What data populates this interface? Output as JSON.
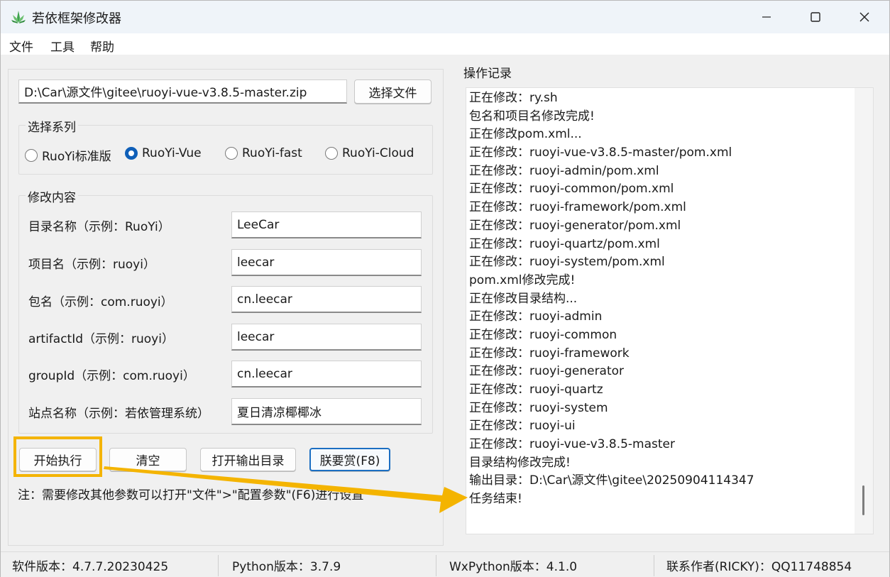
{
  "window": {
    "title": "若依框架修改器",
    "minimize_icon": "minimize-icon",
    "maximize_icon": "maximize-icon",
    "close_icon": "close-icon"
  },
  "menu": [
    "文件",
    "工具",
    "帮助"
  ],
  "file": {
    "path_value": "D:\\Car\\源文件\\gitee\\ruoyi-vue-v3.8.5-master.zip",
    "choose_label": "选择文件"
  },
  "series": {
    "group_label": "选择系列",
    "options": [
      "RuoYi标准版",
      "RuoYi-Vue",
      "RuoYi-fast",
      "RuoYi-Cloud"
    ],
    "selected": "RuoYi-Vue"
  },
  "modify": {
    "group_label": "修改内容",
    "fields": [
      {
        "label": "目录名称（示例：RuoYi）",
        "value": "LeeCar"
      },
      {
        "label": "项目名（示例：ruoyi）",
        "value": "leecar"
      },
      {
        "label": "包名（示例：com.ruoyi）",
        "value": "cn.leecar"
      },
      {
        "label": "artifactId（示例：ruoyi）",
        "value": "leecar"
      },
      {
        "label": "groupId（示例：com.ruoyi）",
        "value": "cn.leecar"
      },
      {
        "label": "站点名称（示例：若依管理系统）",
        "value": "夏日清凉椰椰冰"
      }
    ]
  },
  "actions": {
    "start": "开始执行",
    "clear": "清空",
    "open_output": "打开输出目录",
    "donate": "朕要赏(F8)"
  },
  "note": "注：需要修改其他参数可以打开\"文件\">\"配置参数\"(F6)进行设置",
  "log": {
    "label": "操作记录",
    "lines": [
      "正在修改：ry.sh",
      "包名和项目名修改完成!",
      "正在修改pom.xml...",
      "正在修改：ruoyi-vue-v3.8.5-master/pom.xml",
      "正在修改：ruoyi-admin/pom.xml",
      "正在修改：ruoyi-common/pom.xml",
      "正在修改：ruoyi-framework/pom.xml",
      "正在修改：ruoyi-generator/pom.xml",
      "正在修改：ruoyi-quartz/pom.xml",
      "正在修改：ruoyi-system/pom.xml",
      "pom.xml修改完成!",
      "正在修改目录结构...",
      "正在修改：ruoyi-admin",
      "正在修改：ruoyi-common",
      "正在修改：ruoyi-framework",
      "正在修改：ruoyi-generator",
      "正在修改：ruoyi-quartz",
      "正在修改：ruoyi-system",
      "正在修改：ruoyi-ui",
      "正在修改：ruoyi-vue-v3.8.5-master",
      "目录结构修改完成!",
      "输出目录：D:\\Car\\源文件\\gitee\\20250904114347",
      "任务结束!"
    ]
  },
  "status": {
    "software_version": "软件版本：4.7.7.20230425",
    "python_version": "Python版本：3.7.9",
    "wxpython_version": "WxPython版本：4.1.0",
    "contact": "联系作者(RICKY)：QQ11748854"
  },
  "colors": {
    "highlight": "#f4b400",
    "radio_selected": "#0f5fb8",
    "focused_button": "#1b6ec2"
  }
}
